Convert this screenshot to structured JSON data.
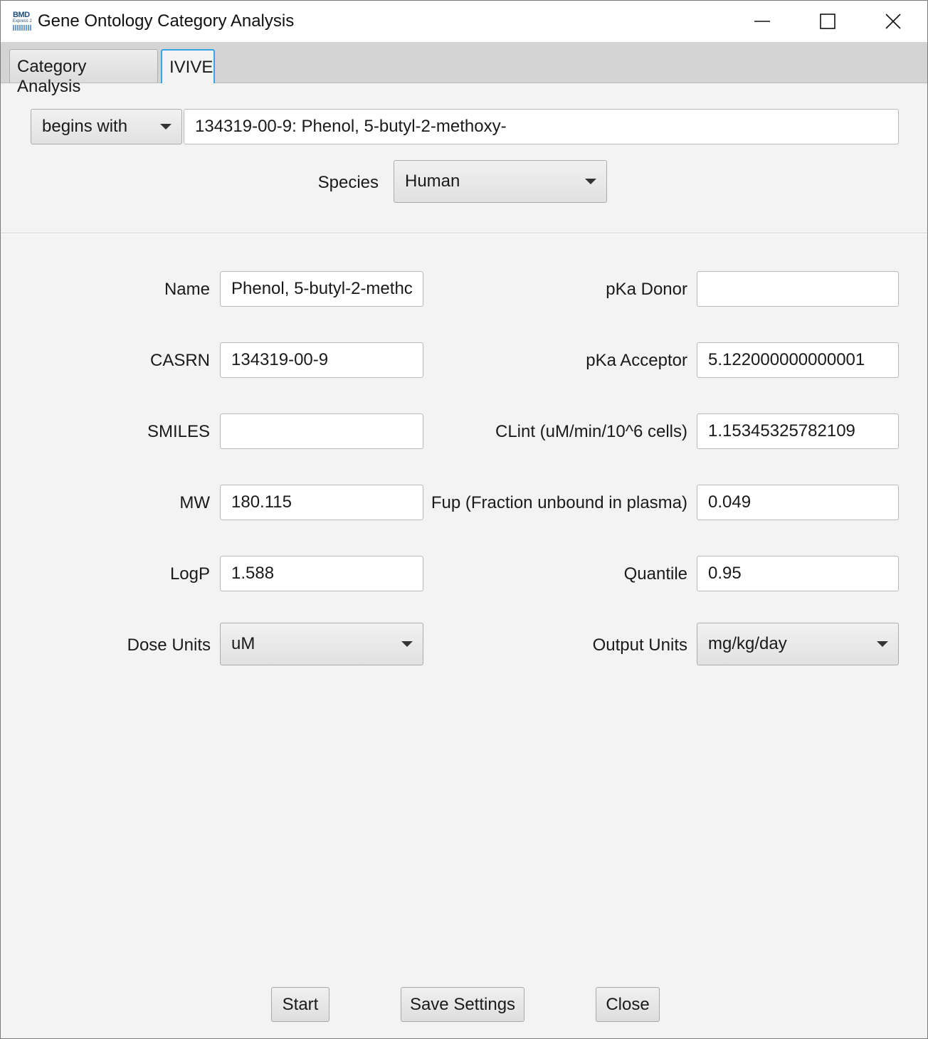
{
  "window": {
    "title": "Gene Ontology Category Analysis",
    "icon_text_top": "BMD",
    "icon_text_bottom": "Express 2",
    "controls": [
      "minimize-icon",
      "maximize-icon",
      "close-icon"
    ]
  },
  "tabs": [
    {
      "label": "Category Analysis",
      "selected": false
    },
    {
      "label": "IVIVE",
      "selected": true
    }
  ],
  "search": {
    "match_mode": "begins with",
    "query": "134319-00-9: Phenol, 5-butyl-2-methoxy-"
  },
  "species": {
    "label": "Species",
    "value": "Human"
  },
  "left_fields": {
    "name": {
      "label": "Name",
      "value": "Phenol, 5-butyl-2-methc"
    },
    "casrn": {
      "label": "CASRN",
      "value": "134319-00-9"
    },
    "smiles": {
      "label": "SMILES",
      "value": ""
    },
    "mw": {
      "label": "MW",
      "value": "180.115"
    },
    "logp": {
      "label": "LogP",
      "value": "1.588"
    },
    "dose_units": {
      "label": "Dose Units",
      "value": "uM"
    }
  },
  "right_fields": {
    "pka_donor": {
      "label": "pKa Donor",
      "value": ""
    },
    "pka_acceptor": {
      "label": "pKa Acceptor",
      "value": "5.122000000000001"
    },
    "clint": {
      "label": "CLint (uM/min/10^6 cells)",
      "value": "1.15345325782109"
    },
    "fup": {
      "label": "Fup (Fraction unbound in plasma)",
      "value": "0.049"
    },
    "quantile": {
      "label": "Quantile",
      "value": "0.95"
    },
    "output_units": {
      "label": "Output Units",
      "value": "mg/kg/day"
    }
  },
  "buttons": {
    "start": "Start",
    "save_settings": "Save Settings",
    "close": "Close"
  },
  "colors": {
    "selected_tab_border": "#3aa3e3",
    "background": "#f3f3f3"
  }
}
